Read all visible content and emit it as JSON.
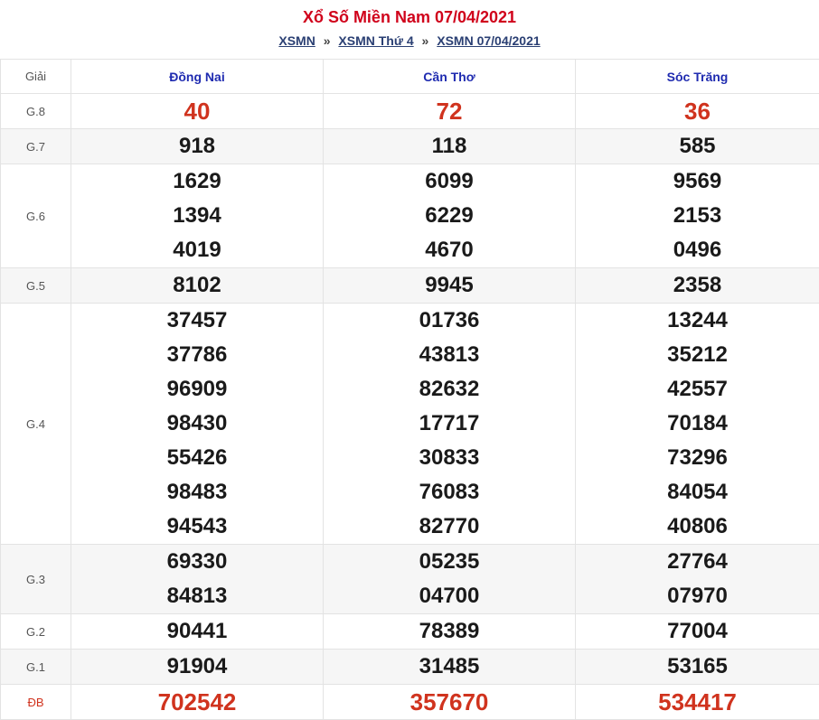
{
  "header": {
    "title": "Xổ Số Miền Nam 07/04/2021",
    "breadcrumbs": [
      "XSMN",
      "XSMN Thứ 4",
      "XSMN 07/04/2021"
    ],
    "separator": "»"
  },
  "table": {
    "label_header": "Giải",
    "provinces": [
      "Đồng Nai",
      "Cần Thơ",
      "Sóc Trăng"
    ],
    "rows": [
      {
        "label": "G.8",
        "values": [
          [
            "40"
          ],
          [
            "72"
          ],
          [
            "36"
          ]
        ]
      },
      {
        "label": "G.7",
        "values": [
          [
            "918"
          ],
          [
            "118"
          ],
          [
            "585"
          ]
        ]
      },
      {
        "label": "G.6",
        "values": [
          [
            "1629",
            "1394",
            "4019"
          ],
          [
            "6099",
            "6229",
            "4670"
          ],
          [
            "9569",
            "2153",
            "0496"
          ]
        ]
      },
      {
        "label": "G.5",
        "values": [
          [
            "8102"
          ],
          [
            "9945"
          ],
          [
            "2358"
          ]
        ]
      },
      {
        "label": "G.4",
        "values": [
          [
            "37457",
            "37786",
            "96909",
            "98430",
            "55426",
            "98483",
            "94543"
          ],
          [
            "01736",
            "43813",
            "82632",
            "17717",
            "30833",
            "76083",
            "82770"
          ],
          [
            "13244",
            "35212",
            "42557",
            "70184",
            "73296",
            "84054",
            "40806"
          ]
        ]
      },
      {
        "label": "G.3",
        "values": [
          [
            "69330",
            "84813"
          ],
          [
            "05235",
            "04700"
          ],
          [
            "27764",
            "07970"
          ]
        ]
      },
      {
        "label": "G.2",
        "values": [
          [
            "90441"
          ],
          [
            "78389"
          ],
          [
            "77004"
          ]
        ]
      },
      {
        "label": "G.1",
        "values": [
          [
            "91904"
          ],
          [
            "31485"
          ],
          [
            "53165"
          ]
        ]
      },
      {
        "label": "ĐB",
        "values": [
          [
            "702542"
          ],
          [
            "357670"
          ],
          [
            "534417"
          ]
        ]
      }
    ]
  }
}
